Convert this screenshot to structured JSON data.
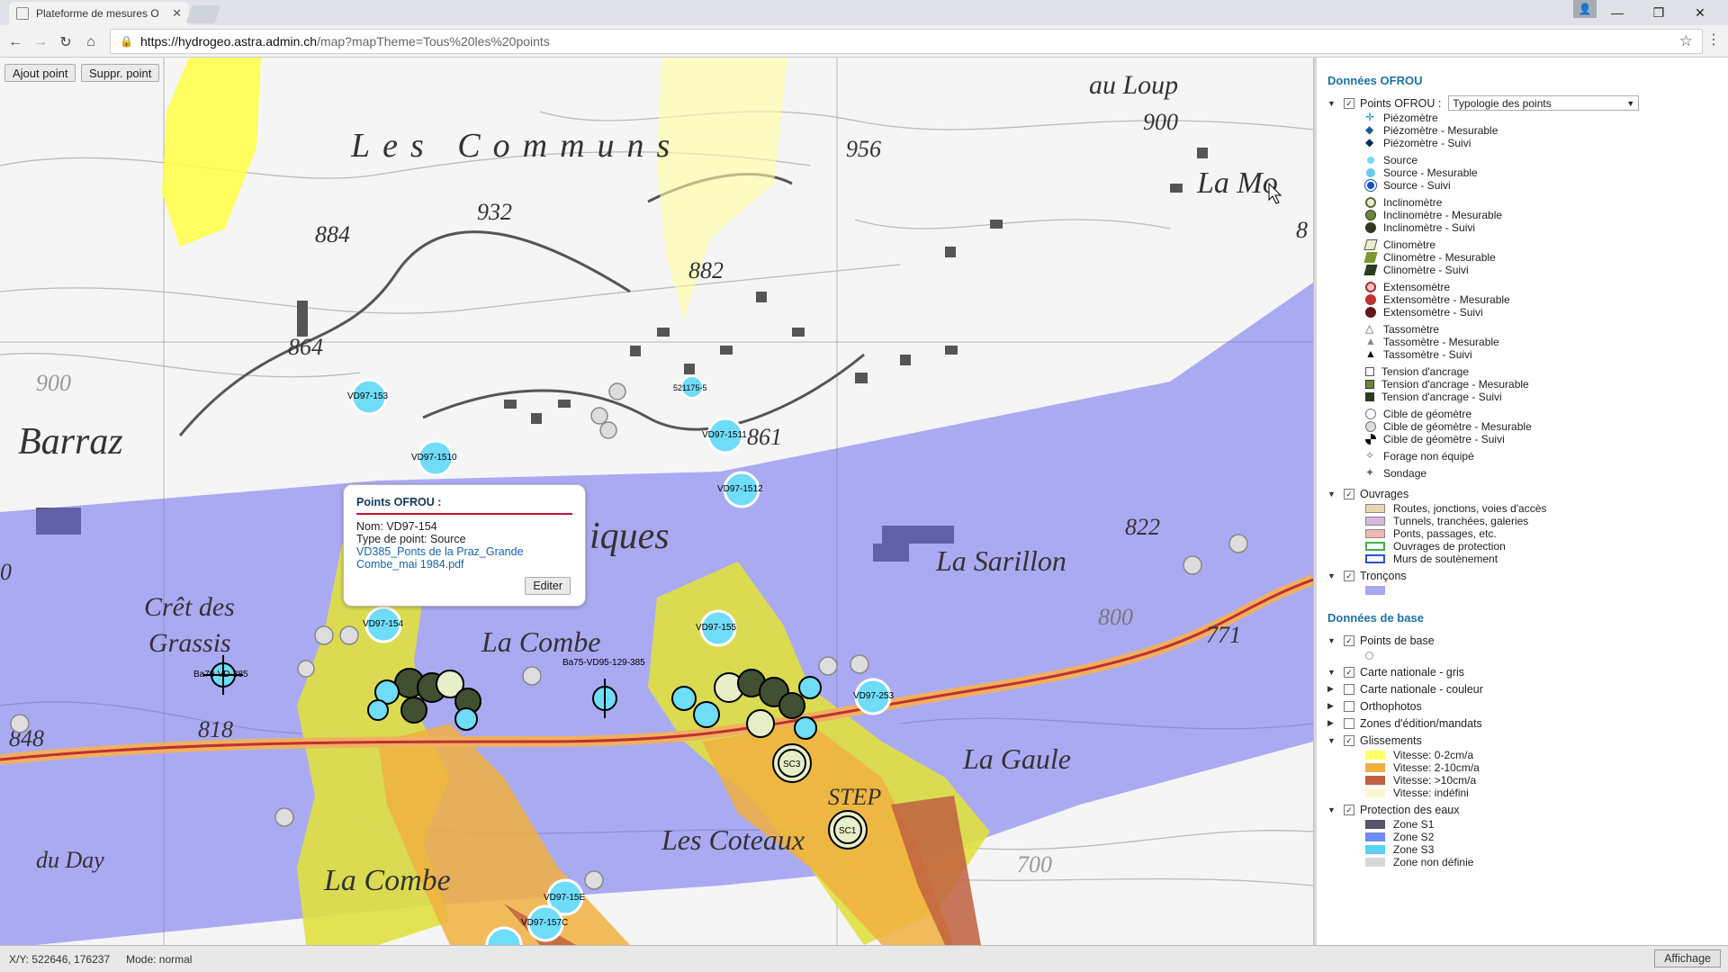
{
  "browser": {
    "tab_title": "Plateforme de mesures O",
    "url_host": "https://hydrogeo.astra.admin.ch",
    "url_path": "/map?mapTheme=Tous%20les%20points"
  },
  "map": {
    "buttons": {
      "add": "Ajout point",
      "remove": "Suppr. point"
    },
    "place_names": [
      "Les Communs",
      "au Loup",
      "La Mo",
      "Barraz",
      "Crêt des",
      "Grassis",
      "La Combe",
      "La Sarillon",
      "La Gaule",
      "Les Coteaux",
      "STEP",
      "La Combe",
      "du Day",
      "iques"
    ],
    "elevations": [
      "956",
      "900",
      "932",
      "884",
      "882",
      "864",
      "900",
      "861",
      "822",
      "800",
      "771",
      "818",
      "848",
      "700",
      "8",
      "0"
    ],
    "point_labels": [
      "VD97-153",
      "VD97-1510",
      "VD97-1511",
      "VD97-1512",
      "521175-5",
      "VD97-154",
      "VD97-155",
      "VD97-253",
      "VD97-15E",
      "VD97-157C",
      "Ba79-VD-385",
      "Ba75-VD95-129-385",
      "SC3",
      "SC1"
    ],
    "popup": {
      "title": "Points OFROU :",
      "name_line": "Nom: VD97-154",
      "type_line": "Type de point: Source",
      "link_line1": "VD385_Ponts de la Praz_Grande",
      "link_line2": "Combe_mai 1984.pdf",
      "edit_label": "Editer"
    }
  },
  "panel": {
    "section1_title": "Données OFROU",
    "points_label": "Points OFROU :",
    "typology_value": "Typologie des points",
    "point_legend": [
      [
        "Piézomètre",
        "Piézomètre - Mesurable",
        "Piézomètre - Suivi"
      ],
      [
        "Source",
        "Source - Mesurable",
        "Source - Suivi"
      ],
      [
        "Inclinomètre",
        "Inclinomètre - Mesurable",
        "Inclinomètre - Suivi"
      ],
      [
        "Clinomètre",
        "Clinomètre - Mesurable",
        "Clinomètre - Suivi"
      ],
      [
        "Extensomètre",
        "Extensomètre - Mesurable",
        "Extensomètre - Suivi"
      ],
      [
        "Tassomètre",
        "Tassomètre - Mesurable",
        "Tassomètre - Suivi"
      ],
      [
        "Tension d'ancrage",
        "Tension d'ancrage - Mesurable",
        "Tension d'ancrage - Suivi"
      ],
      [
        "Cible de géomètre",
        "Cible de géomètre - Mesurable",
        "Cible de géomètre - Suivi"
      ],
      [
        "Forage non équipé"
      ],
      [
        "Sondage"
      ]
    ],
    "ouvrages_label": "Ouvrages",
    "ouvrages_items": [
      "Routes, jonctions, voies d'accès",
      "Tunnels, tranchées, galeries",
      "Ponts, passages, etc.",
      "Ouvrages de protection",
      "Murs de soutènement"
    ],
    "troncons_label": "Tronçons",
    "section2_title": "Données de base",
    "points_base_label": "Points de base",
    "carte_gris_label": "Carte nationale - gris",
    "carte_couleur_label": "Carte nationale - couleur",
    "orthophotos_label": "Orthophotos",
    "zones_label": "Zones d'édition/mandats",
    "glissements_label": "Glissements",
    "glissements_items": [
      "Vitesse: 0-2cm/a",
      "Vitesse: 2-10cm/a",
      "Vitesse: >10cm/a",
      "Vitesse: indéfini"
    ],
    "protection_label": "Protection des eaux",
    "protection_items": [
      "Zone S1",
      "Zone S2",
      "Zone S3",
      "Zone non définie"
    ]
  },
  "colors": {
    "ouvrages": [
      "#e8d8b0",
      "#d8b8e0",
      "#f0b8b0",
      "#8fd08f",
      "#3050d0"
    ],
    "glissements": [
      "#ffff66",
      "#f0b040",
      "#c06040",
      "#fff5d0"
    ],
    "protection": [
      "#55556a",
      "#6c8cf0",
      "#5ad0f5",
      "#d8d8d8"
    ]
  },
  "status": {
    "coords": "X/Y: 522646, 176237",
    "mode": "Mode: normal",
    "affichage": "Affichage"
  }
}
